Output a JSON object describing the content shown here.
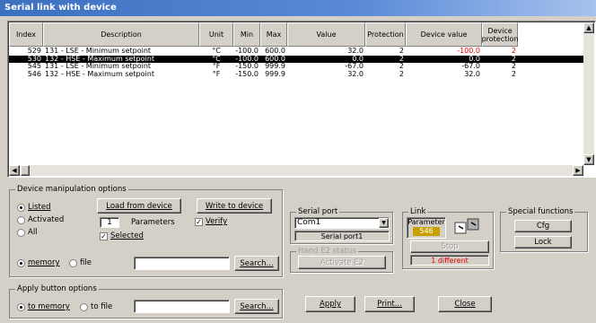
{
  "window": {
    "title": "Serial link with device"
  },
  "table": {
    "headers": [
      "Index",
      "Description",
      "Unit",
      "Min",
      "Max",
      "Value",
      "Protection",
      "Device value",
      "Device protection"
    ],
    "rows": [
      {
        "index": "529",
        "description": "131 - LSE - Minimum setpoint",
        "unit": "°C",
        "min": "-100.0",
        "max": "600.0",
        "value": "32.0",
        "protection": "2",
        "device_value": "-100.0",
        "device_protection": "2",
        "selected": false,
        "device_value_diff": true
      },
      {
        "index": "530",
        "description": "132 - HSE - Maximum setpoint",
        "unit": "°C",
        "min": "-100.0",
        "max": "600.0",
        "value": "0.0",
        "protection": "2",
        "device_value": "0.0",
        "device_protection": "2",
        "selected": true,
        "device_value_diff": false
      },
      {
        "index": "545",
        "description": "131 - LSE - Minimum setpoint",
        "unit": "°F",
        "min": "-150.0",
        "max": "999.9",
        "value": "-67.0",
        "protection": "2",
        "device_value": "-67.0",
        "device_protection": "2",
        "selected": false,
        "device_value_diff": false
      },
      {
        "index": "546",
        "description": "132 - HSE - Maximum setpoint",
        "unit": "°F",
        "min": "-150.0",
        "max": "999.9",
        "value": "32.0",
        "protection": "2",
        "device_value": "32.0",
        "device_protection": "2",
        "selected": false,
        "device_value_diff": false
      }
    ]
  },
  "device_options": {
    "label": "Device manipulation options",
    "radios": [
      "Listed",
      "Activated",
      "All"
    ],
    "load_button": "Load from device",
    "write_button": "Write to device",
    "param_count": "1",
    "param_label": "Parameters",
    "verify_label": "Verify",
    "selected_label": "Selected",
    "memory_label": "memory",
    "file_label": "file",
    "search_button": "Search..."
  },
  "serial_port": {
    "label": "Serial port",
    "value": "Com1",
    "status": "Serial port1"
  },
  "hand_status": {
    "label": "Hand E2 status",
    "button": "Activate E2"
  },
  "link": {
    "label": "Link",
    "param_label": "Parameter",
    "param_value": "546",
    "stop_button": "Stop",
    "status": "1 different",
    "status_color": "#e00000",
    "param_color": "#c8a000"
  },
  "special": {
    "label": "Special functions",
    "cfg_button": "Cfg",
    "lock_button": "Lock"
  },
  "apply_options": {
    "label": "Apply button options",
    "to_memory": "to memory",
    "to_file": "to file",
    "search_button": "Search..."
  },
  "bottom": {
    "apply": "Apply",
    "print": "Print...",
    "close": "Close"
  }
}
